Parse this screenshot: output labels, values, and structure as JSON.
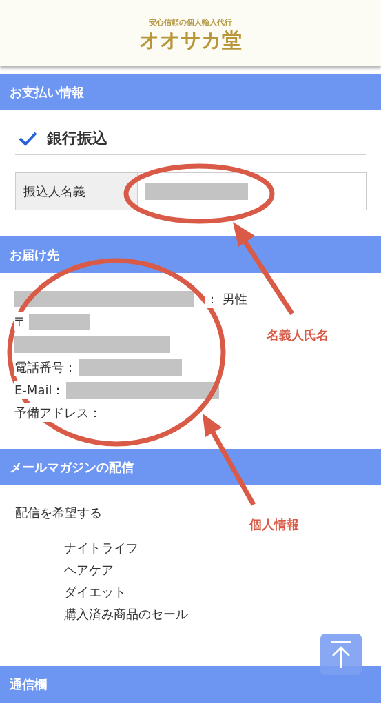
{
  "header": {
    "tagline": "安心信頼の個人輸入代行",
    "logo": "オオサカ堂"
  },
  "payment": {
    "title": "お支払い情報",
    "method": {
      "label": "銀行振込",
      "checked": true
    },
    "field": {
      "label": "振込人名義",
      "redacted": true
    }
  },
  "delivery": {
    "title": "お届け先",
    "lines": [
      {
        "kind": "value_first",
        "text": "：  男性",
        "redacted": true
      },
      {
        "kind": "label_first",
        "text": "〒",
        "redacted": true
      },
      {
        "kind": "value_only",
        "redacted": true
      },
      {
        "kind": "label_first",
        "text": "電話番号：",
        "redacted": true
      },
      {
        "kind": "label_first",
        "text": "E-Mail：",
        "redacted": true
      },
      {
        "kind": "label_first",
        "text": "予備アドレス：",
        "redacted": false
      }
    ]
  },
  "newsletter": {
    "title": "メールマガジンの配信",
    "choice": "配信を希望する",
    "items": [
      "ナイトライフ",
      "ヘアケア",
      "ダイエット",
      "購入済み商品のセール"
    ]
  },
  "notes": {
    "title": "通信欄"
  },
  "annotations": [
    {
      "text": "名義人氏名"
    },
    {
      "text": "個人情報"
    }
  ]
}
